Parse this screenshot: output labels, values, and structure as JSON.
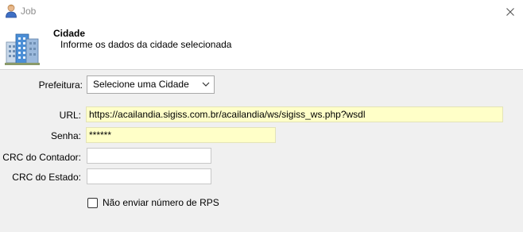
{
  "window": {
    "title": "Job",
    "icon": "user-icon",
    "close_icon": "close-icon"
  },
  "header": {
    "title": "Cidade",
    "subtitle": "Informe os dados da cidade selecionada",
    "icon": "buildings-icon"
  },
  "form": {
    "prefeitura_label": "Prefeitura:",
    "prefeitura_value": "Selecione uma Cidade",
    "url_label": "URL:",
    "url_value": "https://acailandia.sigiss.com.br/acailandia/ws/sigiss_ws.php?wsdl",
    "senha_label": "Senha:",
    "senha_value": "******",
    "crc_contador_label": "CRC do Contador:",
    "crc_contador_value": "",
    "crc_estado_label": "CRC do Estado:",
    "crc_estado_value": "",
    "nao_enviar_rps_label": "Não enviar número de RPS",
    "nao_enviar_rps_checked": false
  },
  "colors": {
    "required_field_bg": "#ffffc8",
    "header_bg": "#ffffff",
    "body_bg": "#f0f0f0"
  }
}
